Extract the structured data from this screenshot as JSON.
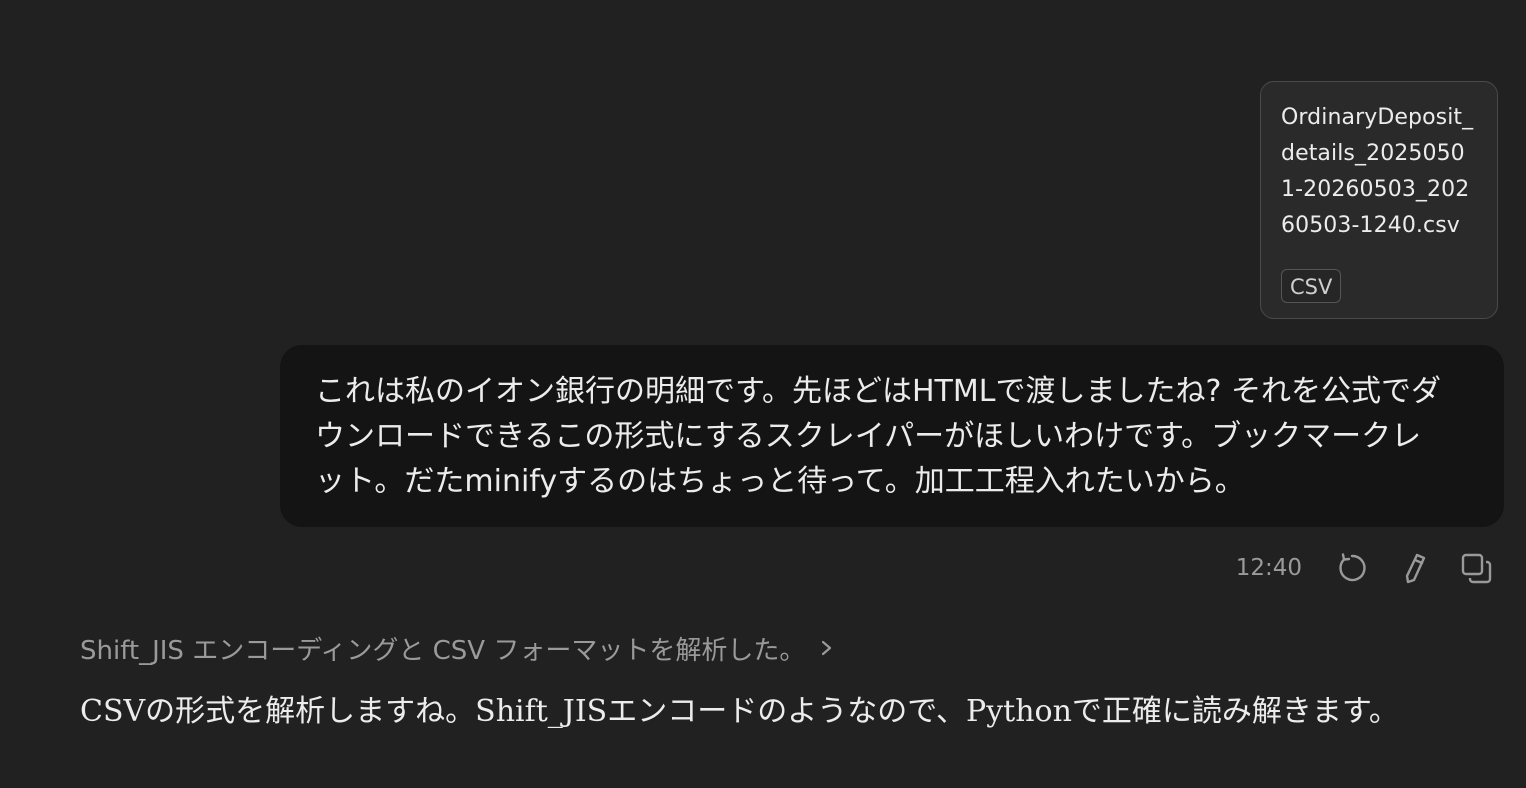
{
  "attachment": {
    "filename": "OrdinaryDeposit_details_20250501-20260503_20260503-1240.csv",
    "type_badge": "CSV"
  },
  "user_message": {
    "text": "これは私のイオン銀行の明細です。先ほどはHTMLで渡しましたね? それを公式でダウンロードできるこの形式にするスクレイパーがほしいわけです。ブックマークレット。だたminifyするのはちょっと待って。加工工程入れたいから。",
    "timestamp": "12:40",
    "actions": {
      "retry_icon": "retry-icon",
      "edit_icon": "pencil-icon",
      "copy_icon": "copy-icon"
    }
  },
  "assistant": {
    "thinking_summary": "Shift_JIS エンコーディングと CSV フォーマットを解析した。",
    "thinking_chevron_icon": "chevron-right-icon",
    "response_text": "CSVの形式を解析しますね。Shift_JISエンコードのようなので、Pythonで正確に読み解きます。"
  },
  "colors": {
    "background": "#212121",
    "user_bubble": "#141414",
    "text_primary": "#ececec",
    "text_muted": "#9a9a9a"
  }
}
